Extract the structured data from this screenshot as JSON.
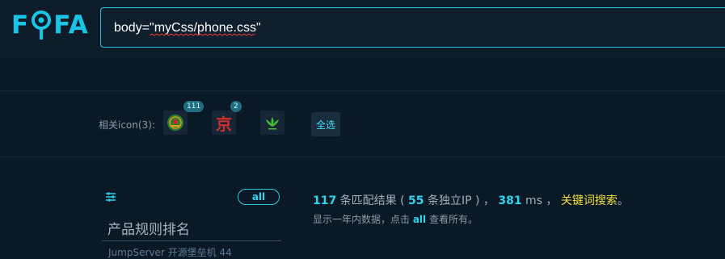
{
  "logo": {
    "text_left": "F",
    "text_right": "FA"
  },
  "search": {
    "query": "body=\"myCss/phone.css\""
  },
  "icons_row": {
    "label": "相关icon(3):",
    "icons": [
      {
        "name": "emblem-icon",
        "count": "111"
      },
      {
        "name": "jd-icon",
        "glyph": "京",
        "count": "2"
      },
      {
        "name": "green-leaf-icon",
        "count": ""
      }
    ],
    "select_all_label": "全选"
  },
  "sidebar": {
    "filter_icon": "sliders-icon",
    "all_label": "all",
    "rank_title": "产品规则排名",
    "rank_peek": "JumpServer 开源堡垒机     44"
  },
  "results": {
    "count": "117",
    "count_suffix": " 条匹配结果 ( ",
    "ip_count": "55",
    "ip_suffix": " 条独立IP ) ，",
    "time": "381",
    "time_unit": " ms ，",
    "keyword_search": "关键词搜索",
    "period": "。",
    "sub_prefix": "显示一年内数据，点击 ",
    "sub_link": "all",
    "sub_suffix": " 查看所有。"
  },
  "colors": {
    "accent": "#2bd6ef",
    "keyword": "#f4e13a",
    "background": "#0b1826"
  }
}
